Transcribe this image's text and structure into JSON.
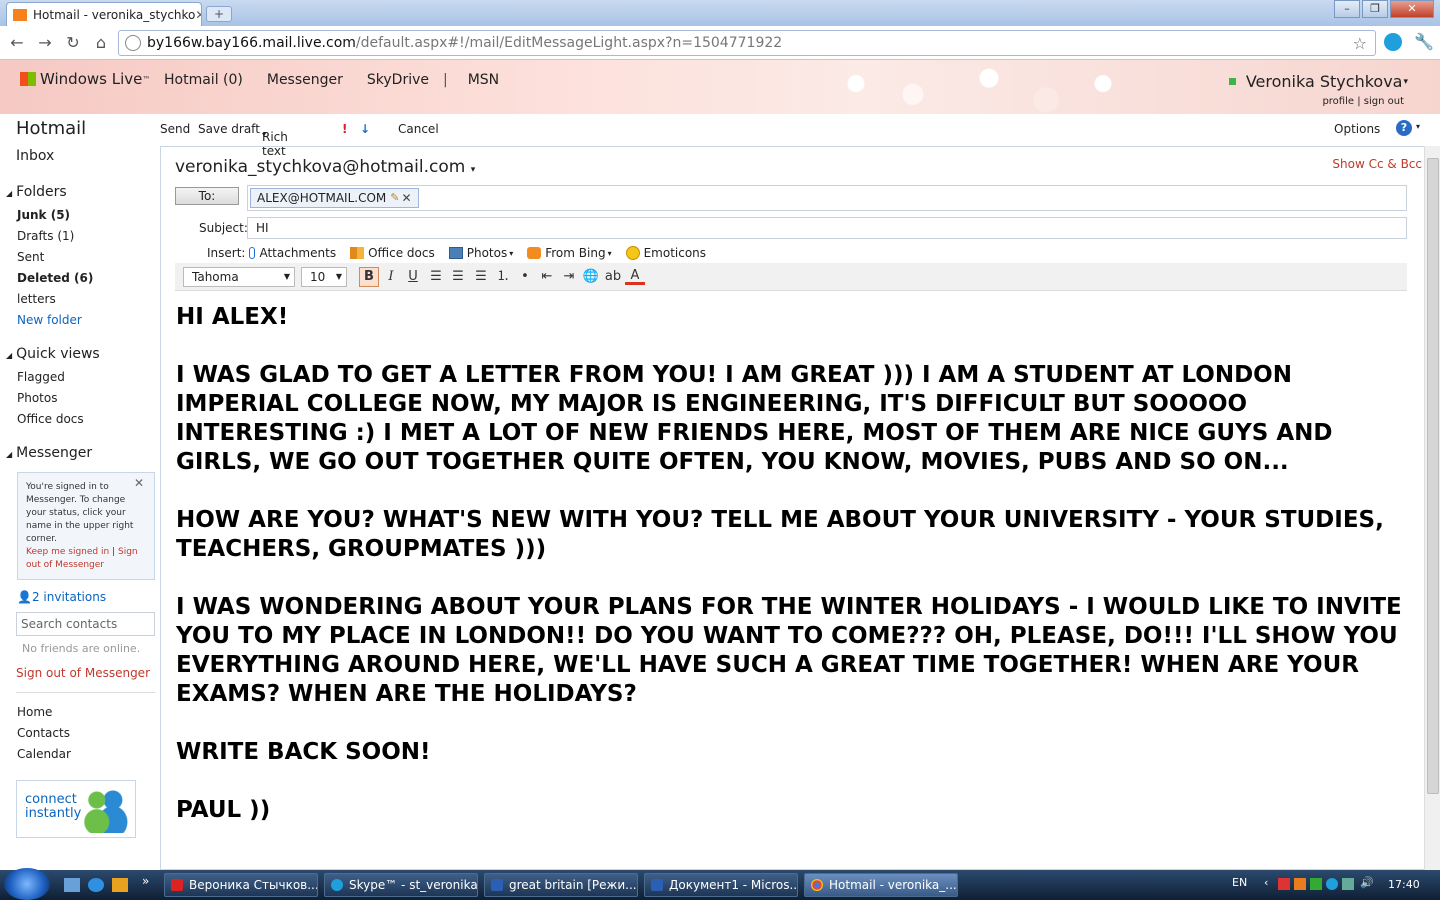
{
  "browser": {
    "tab_title": "Hotmail - veronika_stychko",
    "new_tab": "+",
    "url_host": "by166w.bay166.mail.live.com",
    "url_path": "/default.aspx#!/mail/EditMessageLight.aspx?n=1504771922"
  },
  "header": {
    "brand": "Windows Live",
    "brand_tm": "™",
    "nav": [
      "Hotmail (0)",
      "Messenger",
      "SkyDrive",
      "|",
      "MSN"
    ],
    "user_name": "Veronika Stychkova",
    "profile": "profile",
    "sign_out": "sign out"
  },
  "sidebar": {
    "title": "Hotmail",
    "inbox": "Inbox",
    "folders_heading": "Folders",
    "folders": [
      "Junk (5)",
      "Drafts (1)",
      "Sent",
      "Deleted (6)",
      "letters"
    ],
    "new_folder": "New folder",
    "quick_views_heading": "Quick views",
    "quick_views": [
      "Flagged",
      "Photos",
      "Office docs"
    ],
    "messenger_heading": "Messenger",
    "messenger_box": {
      "text": "You're signed in to Messenger. To change your status, click your name in the upper right corner.",
      "keep_signed": "Keep me signed in",
      "sep": "|",
      "sign_out": "Sign out of Messenger"
    },
    "invitations": "2 invitations",
    "search_placeholder": "Search contacts",
    "no_friends": "No friends are online.",
    "sign_out_messenger": "Sign out of Messenger",
    "bottom_links": [
      "Home",
      "Contacts",
      "Calendar"
    ],
    "connect": "connect instantly"
  },
  "toolbar": {
    "send": "Send",
    "save_draft": "Save draft",
    "rich_text": "Rich text",
    "cancel": "Cancel",
    "options": "Options"
  },
  "compose": {
    "from": "veronika_stychkova@hotmail.com",
    "show_cc": "Show Cc & Bcc",
    "to_label": "To:",
    "to_value": "ALEX@HOTMAIL.COM",
    "subject_label": "Subject:",
    "subject_value": "HI",
    "insert_label": "Insert:",
    "insert_items": [
      "Attachments",
      "Office docs",
      "Photos",
      "From Bing",
      "Emoticons"
    ],
    "font": "Tahoma",
    "size": "10",
    "body": [
      "HI ALEX!",
      "I WAS GLAD TO GET A LETTER FROM YOU! I AM GREAT ))) I AM A STUDENT AT LONDON IMPERIAL COLLEGE NOW, MY MAJOR IS ENGINEERING, IT'S DIFFICULT BUT SOOOOO INTERESTING :) I MET A LOT OF NEW FRIENDS HERE, MOST OF THEM ARE NICE GUYS AND GIRLS, WE GO OUT TOGETHER QUITE OFTEN, YOU KNOW, MOVIES, PUBS AND SO ON...",
      "HOW ARE YOU? WHAT'S NEW WITH YOU? TELL ME ABOUT YOUR UNIVERSITY - YOUR STUDIES, TEACHERS, GROUPMATES )))",
      "I WAS WONDERING ABOUT YOUR PLANS FOR THE WINTER HOLIDAYS - I WOULD LIKE TO INVITE YOU TO MY PLACE IN LONDON!! DO YOU WANT TO COME??? OH, PLEASE, DO!!! I'LL SHOW YOU EVERYTHING AROUND HERE, WE'LL HAVE SUCH A GREAT TIME TOGETHER! WHEN ARE YOUR EXAMS? WHEN ARE THE HOLIDAYS?",
      "WRITE BACK SOON!",
      "PAUL ))"
    ]
  },
  "taskbar": {
    "items": [
      "Вероника Стычков...",
      "Skype™ - st_veronika",
      "great britain [Режи...",
      "Документ1 - Micros...",
      "Hotmail - veronika_..."
    ],
    "lang": "EN",
    "clock": "17:40"
  },
  "colors": {
    "accent_link": "#0b64c0",
    "red_link": "#c0392b"
  }
}
